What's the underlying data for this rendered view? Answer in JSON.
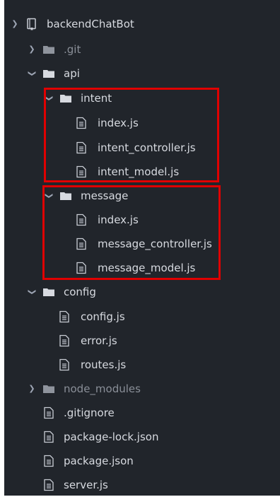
{
  "tree": {
    "root": {
      "label": "backendChatBot",
      "icon": "book-repo-icon"
    },
    "git": {
      "label": ".git",
      "icon": "folder-icon"
    },
    "api": {
      "label": "api",
      "icon": "folder-icon"
    },
    "intent": {
      "label": "intent",
      "files": [
        "index.js",
        "intent_controller.js",
        "intent_model.js"
      ]
    },
    "message": {
      "label": "message",
      "files": [
        "index.js",
        "message_controller.js",
        "message_model.js"
      ]
    },
    "config": {
      "label": "config",
      "files": [
        "config.js",
        "error.js",
        "routes.js"
      ]
    },
    "node_modules": {
      "label": "node_modules",
      "icon": "folder-icon"
    },
    "root_files": [
      ".gitignore",
      "package-lock.json",
      "package.json",
      "server.js"
    ]
  },
  "colors": {
    "panel_bg": "#21252b",
    "text": "#d7dae0",
    "dim_text": "#8a8f98",
    "highlight_border": "#e00000"
  }
}
